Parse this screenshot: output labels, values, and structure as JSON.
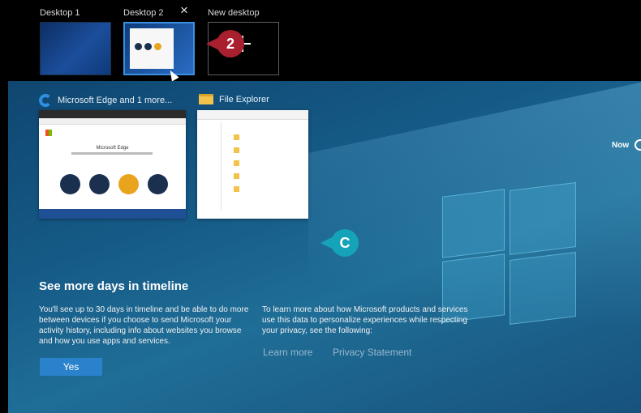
{
  "desktops": {
    "items": [
      {
        "label": "Desktop 1"
      },
      {
        "label": "Desktop 2"
      },
      {
        "label": "New desktop"
      }
    ],
    "close_icon": "×",
    "add_icon": "plus-icon"
  },
  "callouts": {
    "step2": "2",
    "stepC": "C"
  },
  "activities": [
    {
      "title": "Microsoft Edge and 1 more...",
      "icon": "edge-icon",
      "preview_heading": "Microsoft Edge"
    },
    {
      "title": "File Explorer",
      "icon": "folder-icon"
    }
  ],
  "timeline": {
    "now_label": "Now"
  },
  "info": {
    "title": "See more days in timeline",
    "left_text": "You'll see up to 30 days in timeline and be able to do more between devices if you choose to send Microsoft your activity history, including info about websites you browse and how you use apps and services.",
    "right_text": "To learn more about how Microsoft products and services use this data to personalize experiences while respecting your privacy, see the following:",
    "learn_more": "Learn more",
    "privacy": "Privacy Statement",
    "yes_button": "Yes"
  },
  "colors": {
    "accent": "#2a82cc",
    "callout_red": "#a8202e",
    "callout_teal": "#14a3b8"
  }
}
